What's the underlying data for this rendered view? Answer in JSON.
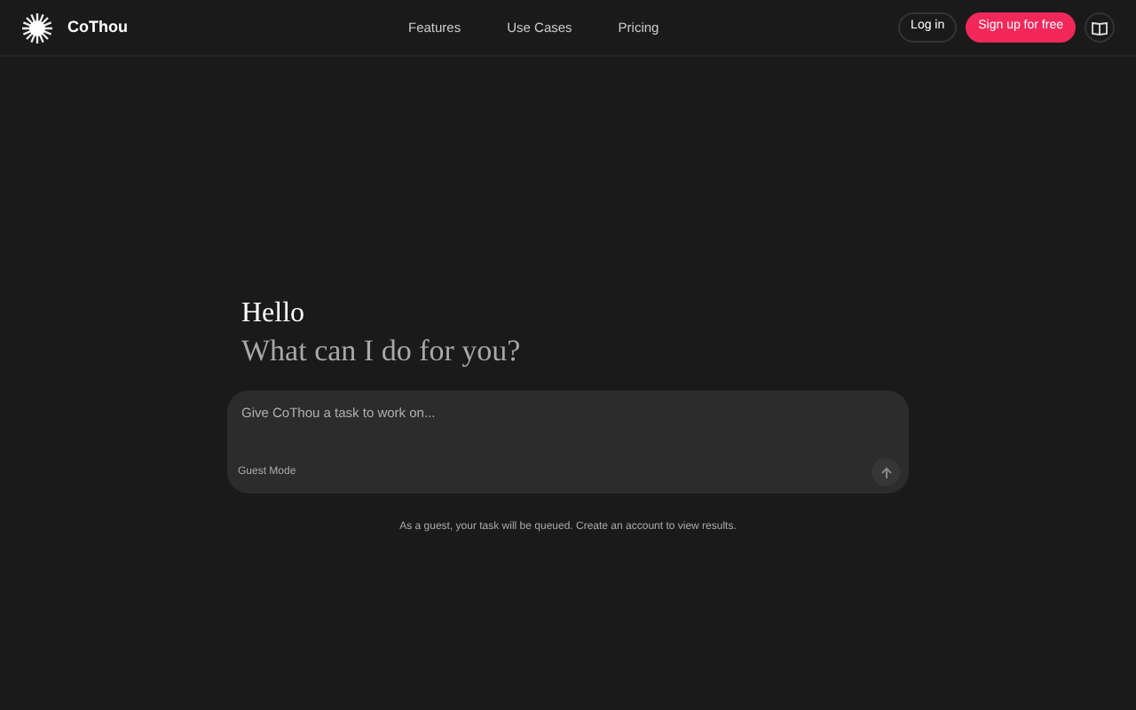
{
  "brand": "CoThou",
  "nav": [
    {
      "label": "Features"
    },
    {
      "label": "Use Cases"
    },
    {
      "label": "Pricing"
    }
  ],
  "login": "Log in",
  "signup": "Sign up for free",
  "greeting": "Hello",
  "prompt": "What can I do for you?",
  "task": {
    "placeholder": "Give CoThou a task to work on...",
    "mode": "Guest Mode"
  },
  "note": "As a guest, your task will be queued. Create an account to view results."
}
